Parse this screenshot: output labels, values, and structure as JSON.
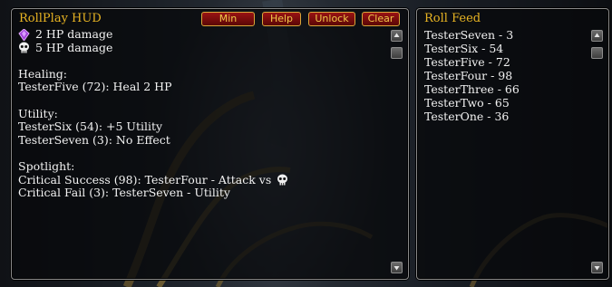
{
  "hud": {
    "title": "RollPlay HUD",
    "buttons": {
      "min": "Min",
      "help": "Help",
      "unlock": "Unlock",
      "clear": "Clear"
    },
    "damage": [
      {
        "icon": "purple-gem-icon",
        "text": "2 HP damage"
      },
      {
        "icon": "skull-icon",
        "text": "5 HP damage"
      }
    ],
    "healing_header": "Healing:",
    "healing_line": "TesterFive (72): Heal 2 HP",
    "utility_header": "Utility:",
    "utility_lines": [
      "TesterSix (54): +5 Utility",
      "TesterSeven (3): No Effect"
    ],
    "spotlight_header": "Spotlight:",
    "spotlight_success": "Critical Success (98): TesterFour - Attack vs",
    "spotlight_fail": "Critical Fail (3): TesterSeven - Utility"
  },
  "feed": {
    "title": "Roll Feed",
    "items": [
      "TesterSeven - 3",
      "TesterSix - 54",
      "TesterFive - 72",
      "TesterFour - 98",
      "TesterThree - 66",
      "TesterTwo - 65",
      "TesterOne - 36"
    ]
  },
  "colors": {
    "title_gold": "#e8b423",
    "button_red": "#8a1010",
    "text": "#f2f2f2"
  }
}
